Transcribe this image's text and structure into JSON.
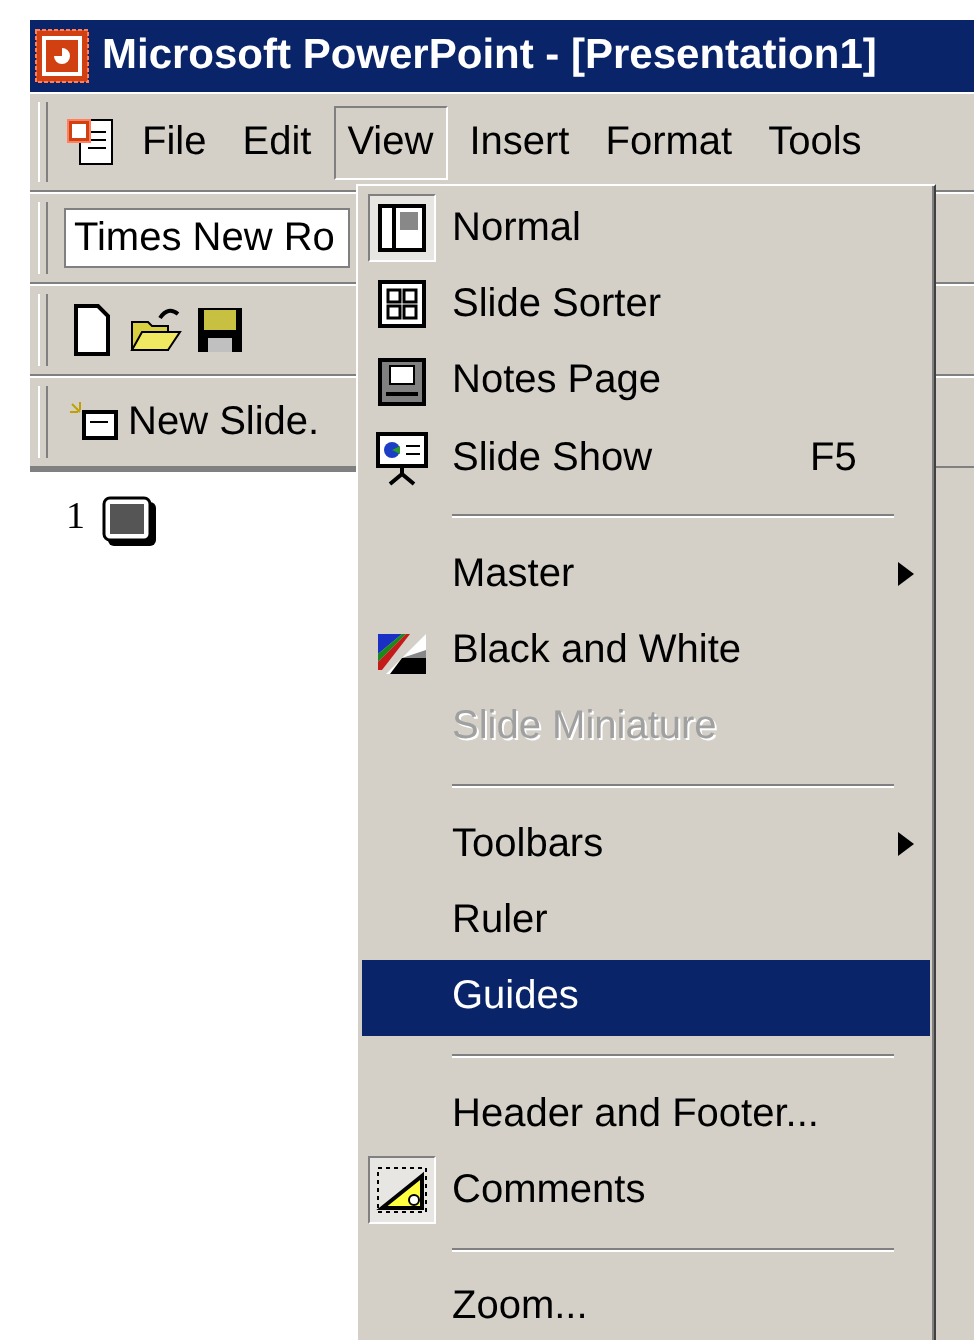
{
  "window": {
    "title": "Microsoft PowerPoint - [Presentation1]"
  },
  "menu_bar": [
    {
      "label": "File",
      "selected": false
    },
    {
      "label": "Edit",
      "selected": false
    },
    {
      "label": "View",
      "selected": true
    },
    {
      "label": "Insert",
      "selected": false
    },
    {
      "label": "Format",
      "selected": false
    },
    {
      "label": "Tools",
      "selected": false
    }
  ],
  "font_field": {
    "value": "Times New Ro"
  },
  "new_slide_button": {
    "label": "New Slide."
  },
  "slides": [
    {
      "number": "1"
    }
  ],
  "view_menu": [
    {
      "kind": "item",
      "label": "Normal",
      "checked": true,
      "disabled": false,
      "selected": false
    },
    {
      "kind": "item",
      "label": "Slide Sorter",
      "checked": false,
      "disabled": false,
      "selected": false
    },
    {
      "kind": "item",
      "label": "Notes Page",
      "checked": false,
      "disabled": false,
      "selected": false
    },
    {
      "kind": "item",
      "label": "Slide Show",
      "shortcut": "F5",
      "checked": false,
      "disabled": false,
      "selected": false
    },
    {
      "kind": "separator"
    },
    {
      "kind": "item",
      "label": "Master",
      "submenu": true,
      "checked": false,
      "disabled": false,
      "selected": false
    },
    {
      "kind": "item",
      "label": "Black and White",
      "checked": false,
      "disabled": false,
      "selected": false
    },
    {
      "kind": "item",
      "label": "Slide Miniature",
      "checked": false,
      "disabled": true,
      "selected": false
    },
    {
      "kind": "separator"
    },
    {
      "kind": "item",
      "label": "Toolbars",
      "submenu": true,
      "checked": false,
      "disabled": false,
      "selected": false
    },
    {
      "kind": "item",
      "label": "Ruler",
      "checked": false,
      "disabled": false,
      "selected": false
    },
    {
      "kind": "item",
      "label": "Guides",
      "checked": false,
      "disabled": false,
      "selected": true
    },
    {
      "kind": "separator"
    },
    {
      "kind": "item",
      "label": "Header and Footer...",
      "checked": false,
      "disabled": false,
      "selected": false
    },
    {
      "kind": "item",
      "label": "Comments",
      "checked": true,
      "disabled": false,
      "selected": false
    },
    {
      "kind": "separator"
    },
    {
      "kind": "item",
      "label": "Zoom...",
      "checked": false,
      "disabled": false,
      "selected": false
    }
  ]
}
